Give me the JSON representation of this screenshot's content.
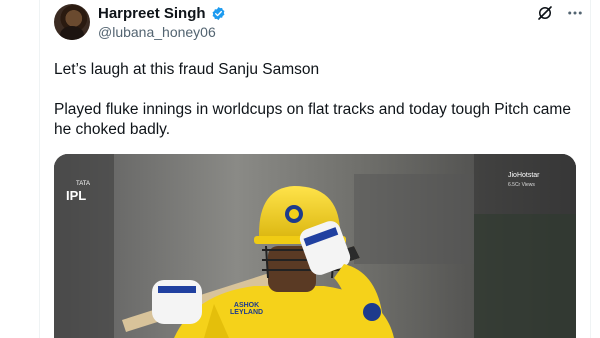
{
  "tweet": {
    "display_name": "Harpreet Singh",
    "handle": "@lubana_honey06",
    "verified": true,
    "text_line1": "Let’s laugh at this fraud Sanju Samson",
    "text_line2": "Played fluke innings in worldcups on flat tracks and today tough Pitch came he choked badly."
  },
  "icons": {
    "verified": "verified-badge-icon",
    "grok": "grok-icon",
    "more": "more-icon"
  },
  "media": {
    "logo_small": "TATA",
    "logo_main": "IPL",
    "broadcaster": "JioHotstar",
    "views": "6.5Cr Views",
    "jersey_line1": "ASHOK",
    "jersey_line2": "LEYLAND"
  },
  "colors": {
    "verified": "#1d9bf0",
    "jersey": "#f5d21a",
    "text_secondary": "#536471"
  }
}
